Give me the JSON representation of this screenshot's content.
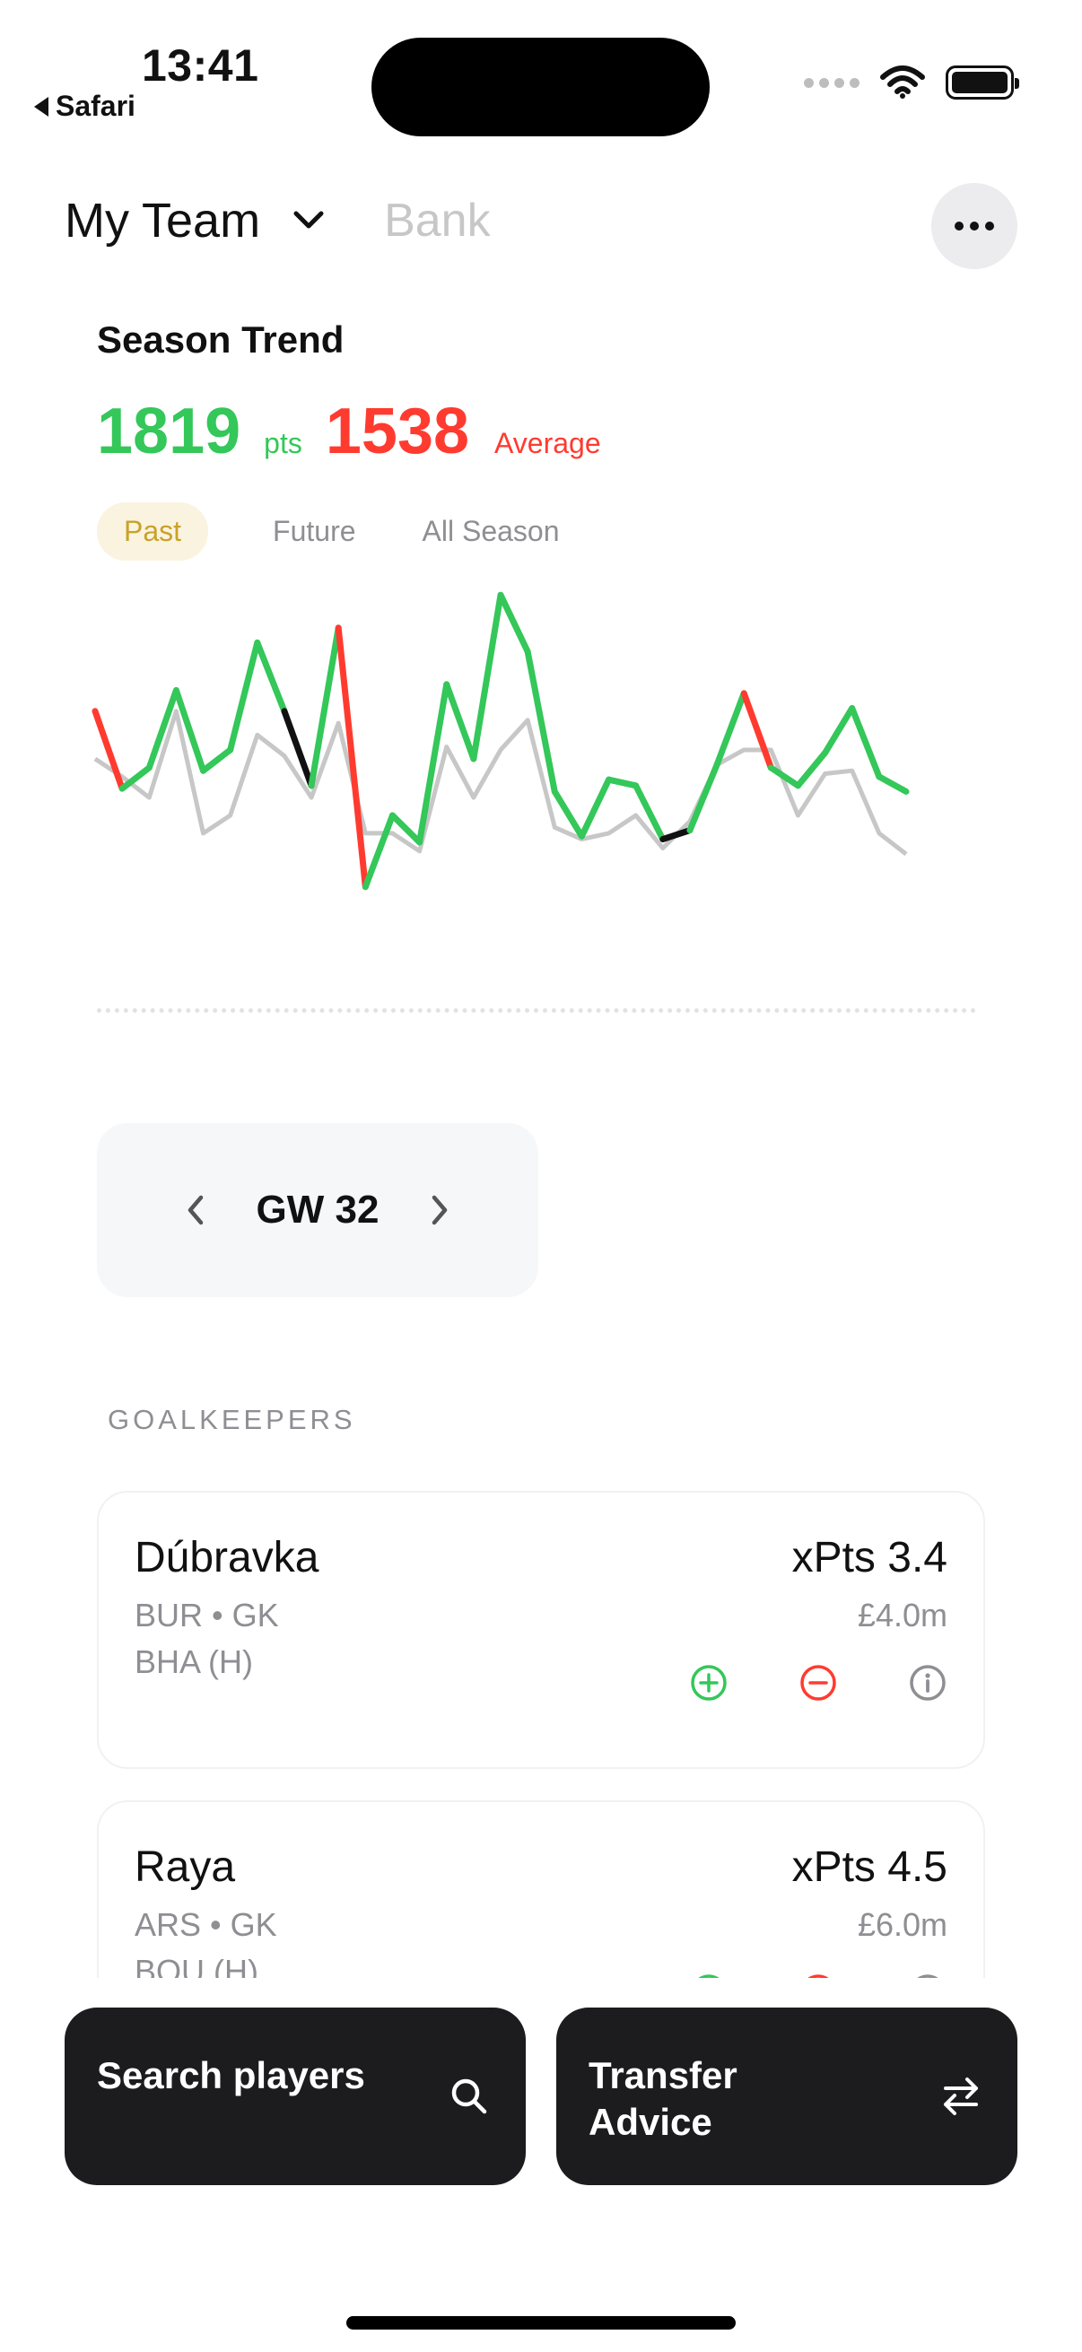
{
  "status_bar": {
    "time": "13:41",
    "back_app": "Safari"
  },
  "header": {
    "title": "My Team",
    "bank_label": "Bank"
  },
  "season_trend": {
    "title": "Season Trend",
    "points": "1819",
    "points_label": "pts",
    "average": "1538",
    "average_label": "Average",
    "filters": [
      "Past",
      "Future",
      "All Season"
    ],
    "active_filter": "Past"
  },
  "chart_data": {
    "type": "line",
    "series": [
      {
        "values": [
          60,
          34,
          41,
          67,
          40,
          47,
          83,
          60,
          35,
          88,
          1,
          25,
          16,
          69,
          44,
          99,
          80,
          33,
          18,
          37,
          35,
          17,
          20,
          42,
          66,
          41,
          35,
          46,
          61,
          38,
          33
        ],
        "segment_colors": [
          "red",
          "green",
          "green",
          "green",
          "green",
          "green",
          "green",
          "black",
          "green",
          "red",
          "green",
          "green",
          "green",
          "green",
          "green",
          "green",
          "green",
          "green",
          "green",
          "green",
          "green",
          "black",
          "green",
          "green",
          "red",
          "green",
          "green",
          "green",
          "green",
          "green"
        ],
        "color": "#34c759"
      },
      {
        "values": [
          44,
          38,
          31,
          60,
          19,
          25,
          52,
          45,
          31,
          56,
          19,
          19,
          13,
          48,
          31,
          47,
          57,
          21,
          17,
          19,
          25,
          14,
          23,
          42,
          47,
          47,
          25,
          39,
          40,
          19,
          12
        ],
        "color": "#c7c7c7"
      }
    ]
  },
  "gameweek": {
    "label": "GW 32"
  },
  "section": {
    "title": "GOALKEEPERS"
  },
  "players": [
    {
      "name": "Dúbravka",
      "team_pos": "BUR • GK",
      "fixture": "BHA (H)",
      "xpts": "xPts 3.4",
      "price": "£4.0m"
    },
    {
      "name": "Raya",
      "team_pos": "ARS • GK",
      "fixture": "BOU (H)",
      "xpts": "xPts 4.5",
      "price": "£6.0m"
    }
  ],
  "actions": {
    "search": "Search players",
    "transfer": "Transfer Advice"
  },
  "colors": {
    "green": "#34c759",
    "red": "#ff3b30",
    "gray": "#8e8e93",
    "dark": "#1c1c1e"
  }
}
